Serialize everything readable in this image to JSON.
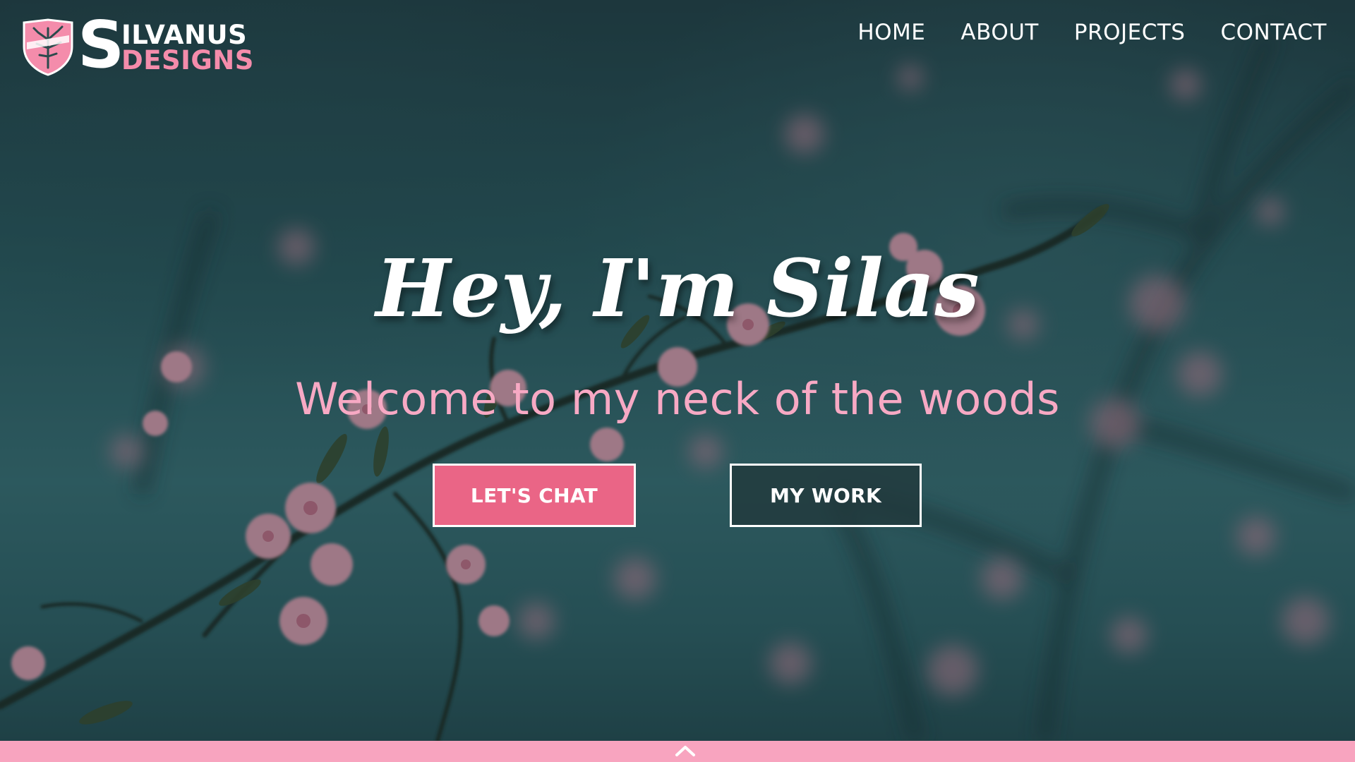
{
  "logo": {
    "initial": "S",
    "line1": "ILVANUS",
    "line2": "DESIGNS",
    "icon": "shield-tree-icon"
  },
  "nav": {
    "items": [
      {
        "label": "HOME"
      },
      {
        "label": "ABOUT"
      },
      {
        "label": "PROJECTS"
      },
      {
        "label": "CONTACT"
      }
    ]
  },
  "hero": {
    "headline": "Hey, I'm Silas",
    "subline": "Welcome to my neck of the woods",
    "background_image": "pink-blossom-branches-on-teal-sky"
  },
  "buttons": {
    "chat_label": "LET'S CHAT",
    "work_label": "MY WORK"
  },
  "footer": {
    "scroll_icon": "chevron-up-icon"
  },
  "colors": {
    "accent_pink": "#ea6586",
    "light_pink": "#f7a9c4",
    "footer_pink": "#f8a4bf",
    "teal_background": "#2a5b60"
  }
}
